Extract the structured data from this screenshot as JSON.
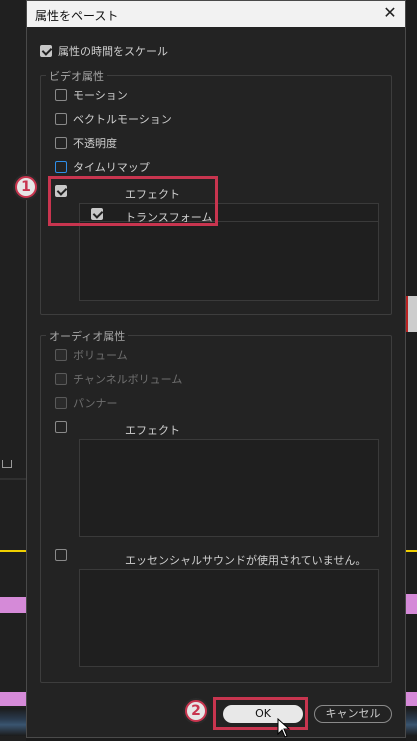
{
  "dialog": {
    "title": "属性をペースト",
    "close_glyph": "✕",
    "scale_timing": {
      "label": "属性の時間をスケール",
      "checked": true
    }
  },
  "video": {
    "group_label": "ビデオ属性",
    "items": [
      {
        "label": "モーション",
        "checked": false
      },
      {
        "label": "ベクトルモーション",
        "checked": false
      },
      {
        "label": "不透明度",
        "checked": false
      },
      {
        "label": "タイムリマップ",
        "checked": false,
        "focused": true
      }
    ],
    "effects": {
      "label": "エフェクト",
      "checked": true,
      "sub_items": [
        {
          "label": "トランスフォーム",
          "checked": true
        }
      ]
    }
  },
  "audio": {
    "group_label": "オーディオ属性",
    "items": [
      {
        "label": "ボリューム",
        "disabled": true
      },
      {
        "label": "チャンネルボリューム",
        "disabled": true
      },
      {
        "label": "パンナー",
        "disabled": true
      }
    ],
    "effects": {
      "label": "エフェクト",
      "checked": false
    },
    "essential_sound": {
      "label": "エッセンシャルサウンドが使用されていません。",
      "checked": false
    }
  },
  "buttons": {
    "ok": "OK",
    "cancel": "キャンセル"
  },
  "annotations": {
    "marker_1": "1",
    "marker_2": "2",
    "highlight_color": "#c8354f"
  },
  "colors": {
    "accent_focus": "#2f8ee8",
    "dialog_bg": "#232323",
    "titlebar_bg": "#f2f2f2"
  }
}
